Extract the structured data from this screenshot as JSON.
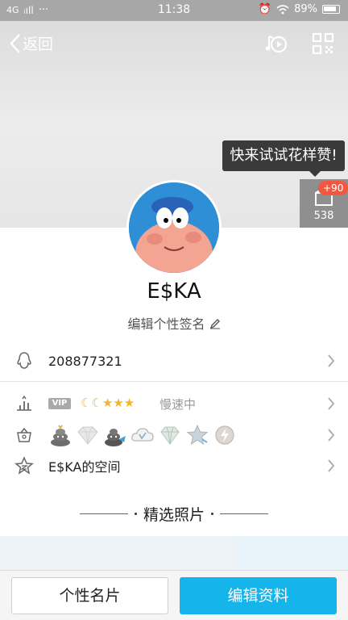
{
  "status_bar": {
    "network": "4G",
    "signal": "ᵢıll",
    "dots": "···",
    "time": "11:38",
    "battery": "89%"
  },
  "nav": {
    "back_label": "返回",
    "icons": [
      "music-icon",
      "qr-code-icon"
    ]
  },
  "like": {
    "tooltip": "快来试试花样赞!",
    "badge": "+90",
    "count": "538"
  },
  "profile": {
    "nickname": "E$KA",
    "signature": "编辑个性签名"
  },
  "info": {
    "qq_number": "208877321",
    "vip_badge": "VIP",
    "level_icons": "☾☾★★★",
    "speed_status": "慢速中",
    "space_label": "E$KA的空间"
  },
  "medals": [
    "poop-medal-icon",
    "diamond-medal-icon",
    "poop-medal-icon-2",
    "cloud-medal-icon",
    "gem-medal-icon",
    "star-medal-icon",
    "bolt-medal-icon"
  ],
  "section": {
    "title": "精选照片"
  },
  "actions": {
    "card_label": "个性名片",
    "edit_label": "编辑资料"
  },
  "colors": {
    "accent": "#15b5ec",
    "badge": "#f4573f",
    "level": "#f3b62b"
  }
}
